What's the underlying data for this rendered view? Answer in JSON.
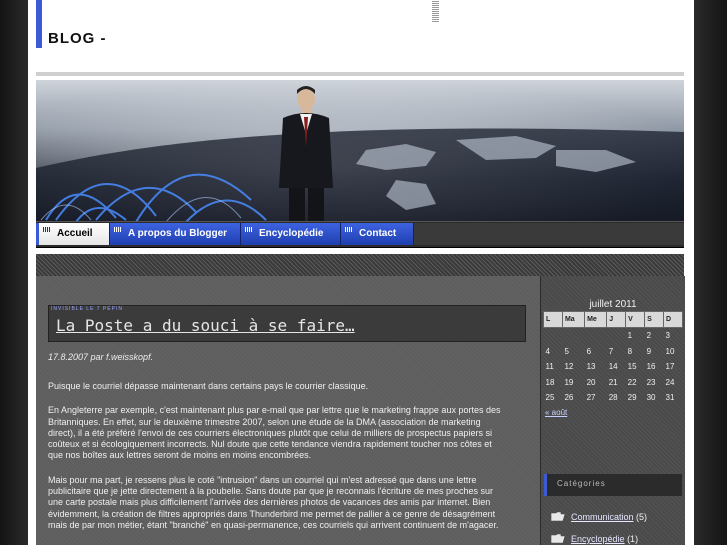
{
  "blog": {
    "title": "BLOG -"
  },
  "nav": {
    "tabs": [
      {
        "label": "Accueil",
        "active": true
      },
      {
        "label": "A propos du Blogger",
        "active": false
      },
      {
        "label": "Encyclopédie",
        "active": false
      },
      {
        "label": "Contact",
        "active": false
      }
    ]
  },
  "post": {
    "tag": "INVISIBLE LE 7 PÉPIN",
    "title": "La Poste a du souci à se faire…",
    "date_line": "17.8.2007 par f.weisskopf.",
    "paragraphs": [
      "Puisque le courriel dépasse maintenant dans certains pays le courrier classique.",
      "En Angleterre par exemple, c'est maintenant plus par e-mail que par lettre que le marketing frappe aux portes des Britanniques.  En effet, sur le deuxième trimestre 2007, selon une étude de la DMA (association de marketing direct), il a été préféré l'envoi de ces courriers électroniques plutôt que celui de milliers de prospectus papiers si coûteux et si écologiquement incorrects. Nul doute que cette tendance viendra rapidement toucher nos côtes et que nos boîtes aux lettres seront de moins en moins encombrées.",
      "Mais pour ma part, je ressens plus le coté \"intrusion\" dans un courriel qui m'est adressé que dans une lettre publicitaire que je jette directement à la poubelle. Sans doute par que je reconnais l'écriture de mes proches sur une carte postale mais plus difficilement l'arrivée des dernières photos de vacances des amis par internet. Bien évidemment, la création de filtres appropriés dans Thunderbird me permet de pallier à ce genre de désagrément mais de par mon métier, étant \"branché\" en quasi-permanence, ces courriels qui arrivent continuent de m'agacer."
    ]
  },
  "calendar": {
    "caption": "juillet 2011",
    "weekdays": [
      "L",
      "Ma",
      "Me",
      "J",
      "V",
      "S",
      "D"
    ],
    "weeks": [
      [
        "",
        "",
        "",
        "",
        "1",
        "2",
        "3"
      ],
      [
        "4",
        "5",
        "6",
        "7",
        "8",
        "9",
        "10"
      ],
      [
        "11",
        "12",
        "13",
        "14",
        "15",
        "16",
        "17"
      ],
      [
        "18",
        "19",
        "20",
        "21",
        "22",
        "23",
        "24"
      ],
      [
        "25",
        "26",
        "27",
        "28",
        "29",
        "30",
        "31"
      ]
    ],
    "prev_link": "« août"
  },
  "categories": {
    "heading": "Catégories",
    "items": [
      {
        "label": "Communication",
        "count": "(5)"
      },
      {
        "label": "Encyclopédie",
        "count": "(1)"
      }
    ]
  },
  "colors": {
    "accent": "#3b5bd6",
    "nav_blue": "#2e4fc8",
    "content_bg": "#5e5e5e",
    "sidebar_bg": "#4a4a4a"
  },
  "icons": {
    "category_item": "folder-icon",
    "nav_tab": "dotted-grip-icon"
  }
}
